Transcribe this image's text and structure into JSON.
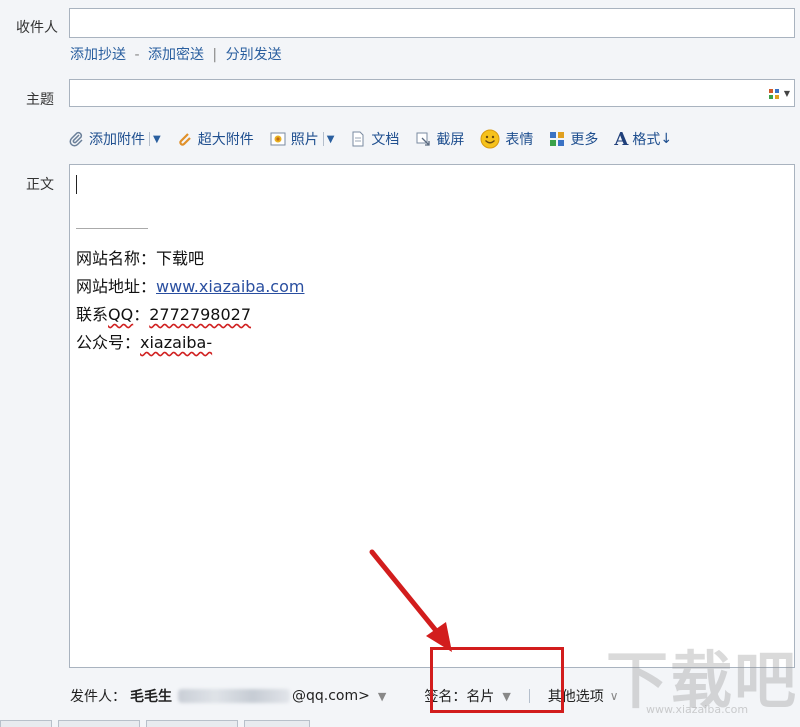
{
  "to": {
    "label": "收件人",
    "value": ""
  },
  "cc_links": [
    "添加抄送",
    "添加密送",
    "分别发送"
  ],
  "cc_seps": [
    "-",
    "|"
  ],
  "subject": {
    "label": "主题",
    "value": ""
  },
  "toolbar": {
    "attach": "添加附件",
    "large_attach": "超大附件",
    "photo": "照片",
    "document": "文档",
    "screenshot": "截屏",
    "emoji": "表情",
    "more": "更多",
    "format": "格式",
    "format_arrow": "↓"
  },
  "body": {
    "label": "正文",
    "signature": [
      {
        "key": "网站名称：",
        "value": "下载吧"
      },
      {
        "key": "网站地址：",
        "value": "www.xiazaiba.com"
      },
      {
        "key": "联系",
        "key2": "QQ",
        "colon": "：",
        "value": "2772798027"
      },
      {
        "key": "公众号：",
        "value": "xiazaiba-"
      }
    ]
  },
  "footer": {
    "sender_label": "发件人：",
    "sender_name": "毛毛生",
    "sender_email_suffix": "@qq.com>",
    "signature_label": "签名：名片",
    "other_options": "其他选项",
    "dropdown_glyph": "▼",
    "options_glyph": "∨"
  },
  "watermark": {
    "text": "下载吧",
    "sub": "www.xiazaiba.com"
  },
  "colors": {
    "link": "#2a5f9f",
    "annotation": "#d21d1d"
  },
  "icons": [
    "paperclip-icon",
    "large-clip-icon",
    "photo-icon",
    "document-icon",
    "screenshot-icon",
    "smiley-icon",
    "grid-icon",
    "format-a-icon",
    "layout-grid-icon"
  ]
}
